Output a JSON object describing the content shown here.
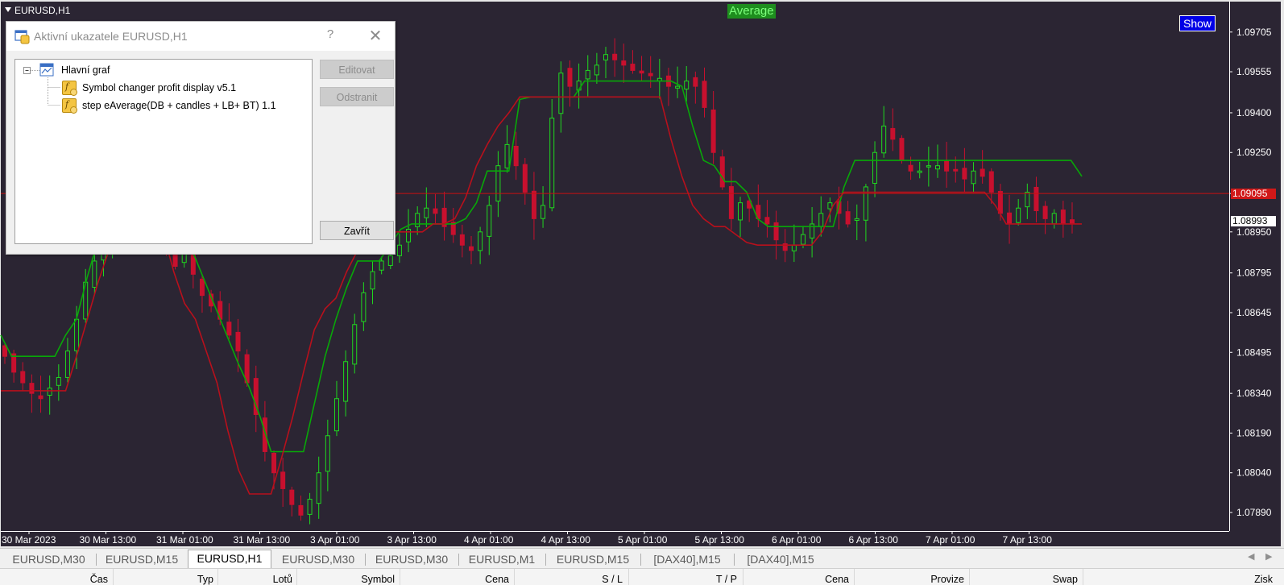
{
  "chart": {
    "title": "EURUSD,H1",
    "indicator_label": "Average",
    "show_button": "Show",
    "bid_price": "1.09095",
    "ask_price": "1.08993",
    "colors": {
      "background": "#2b2533",
      "bull": "#1fd81f",
      "bear": "#c8102e",
      "upper_line": "#08a808",
      "lower_line": "#b8101c",
      "price_line": "#c81010"
    }
  },
  "chart_data": {
    "type": "candlestick",
    "symbol": "EURUSD",
    "timeframe": "H1",
    "ylim": [
      1.0782,
      1.0982
    ],
    "y_ticks": [
      "1.09705",
      "1.09555",
      "1.09400",
      "1.09250",
      "1.09095",
      "1.08950",
      "1.08795",
      "1.08645",
      "1.08495",
      "1.08340",
      "1.08190",
      "1.08040",
      "1.07890"
    ],
    "x_ticks": [
      "30 Mar 2023",
      "30 Mar 13:00",
      "31 Mar 01:00",
      "31 Mar 13:00",
      "3 Apr 01:00",
      "3 Apr 13:00",
      "4 Apr 01:00",
      "4 Apr 13:00",
      "5 Apr 01:00",
      "5 Apr 13:00",
      "6 Apr 01:00",
      "6 Apr 13:00",
      "7 Apr 01:00",
      "7 Apr 13:00"
    ],
    "close_series": [
      1.0848,
      1.0842,
      1.0838,
      1.0834,
      1.0832,
      1.0836,
      1.084,
      1.085,
      1.0862,
      1.0876,
      1.0884,
      1.089,
      1.09,
      1.0908,
      1.0912,
      1.0906,
      1.0898,
      1.0893,
      1.0888,
      1.0882,
      1.0888,
      1.0879,
      1.0871,
      1.0867,
      1.0862,
      1.0856,
      1.085,
      1.0838,
      1.0826,
      1.0812,
      1.0804,
      1.0798,
      1.0792,
      1.0788,
      1.0794,
      1.0804,
      1.0818,
      1.0832,
      1.0846,
      1.086,
      1.0872,
      1.088,
      1.0884,
      1.0886,
      1.089,
      1.0896,
      1.0902,
      1.0904,
      1.0902,
      1.0897,
      1.0894,
      1.089,
      1.0888,
      1.0895,
      1.0905,
      1.092,
      1.0928,
      1.092,
      1.091,
      1.09,
      1.0905,
      1.0938,
      1.0955,
      1.095,
      1.0952,
      1.0956,
      1.0958,
      1.0962,
      1.096,
      1.0958,
      1.0956,
      1.0955,
      1.0954,
      1.0953,
      1.095,
      1.095,
      1.0952,
      1.095,
      1.0942,
      1.0925,
      1.0912,
      1.09,
      1.0906,
      1.0904,
      1.09,
      1.0898,
      1.0892,
      1.0888,
      1.089,
      1.0894,
      1.0898,
      1.0902,
      1.0906,
      1.0902,
      1.0898,
      1.09,
      1.0912,
      1.0925,
      1.0935,
      1.093,
      1.0922,
      1.0918,
      1.0918,
      1.092,
      1.092,
      1.0918,
      1.0918,
      1.0915,
      1.0918,
      1.0916,
      1.091,
      1.0902,
      1.0898,
      1.0904,
      1.091,
      1.0903,
      1.09,
      1.0902,
      1.0898,
      1.0898
    ],
    "series": [
      {
        "name": "upper",
        "values": [
          1.0856,
          1.0848,
          1.0848,
          1.0848,
          1.0848,
          1.0848,
          1.0856,
          1.0862,
          1.0878,
          1.0892,
          1.09,
          1.0902,
          1.0905,
          1.091,
          1.091,
          1.091,
          1.0903,
          1.0895,
          1.0885,
          1.0875,
          1.0865,
          1.0855,
          1.0845,
          1.0836,
          1.0825,
          1.0812,
          1.0812,
          1.0812,
          1.0812,
          1.083,
          1.0848,
          1.0862,
          1.0874,
          1.0884,
          1.0884,
          1.0884,
          1.089,
          1.0896,
          1.0898,
          1.0898,
          1.0898,
          1.0898,
          1.0898,
          1.09,
          1.0906,
          1.0918,
          1.0918,
          1.0918,
          1.0945,
          1.0946,
          1.0946,
          1.0946,
          1.0946,
          1.0946,
          1.0952,
          1.0952,
          1.0952,
          1.0952,
          1.0952,
          1.0952,
          1.0952,
          1.0952,
          1.0952,
          1.095,
          1.0935,
          1.0922,
          1.092,
          1.0914,
          1.0914,
          1.091,
          1.09,
          1.0897,
          1.0897,
          1.0897,
          1.0897,
          1.0897,
          1.0897,
          1.0897,
          1.0912,
          1.0922,
          1.0922,
          1.0922,
          1.0922,
          1.0922,
          1.0922,
          1.0922,
          1.0922,
          1.0922,
          1.0922,
          1.0922,
          1.0922,
          1.0922,
          1.0922,
          1.0922,
          1.0922,
          1.0922,
          1.0922,
          1.0922,
          1.0922,
          1.0922,
          1.0916
        ]
      },
      {
        "name": "lower",
        "values": [
          1.0835,
          1.0835,
          1.0835,
          1.0835,
          1.0835,
          1.0835,
          1.0835,
          1.0848,
          1.0862,
          1.0876,
          1.0888,
          1.0893,
          1.0895,
          1.0895,
          1.0895,
          1.0895,
          1.088,
          1.0868,
          1.0862,
          1.085,
          1.0838,
          1.082,
          1.0805,
          1.0796,
          1.0796,
          1.0796,
          1.081,
          1.0825,
          1.0842,
          1.0858,
          1.0866,
          1.087,
          1.088,
          1.0888,
          1.0892,
          1.0892,
          1.0895,
          1.0895,
          1.0895,
          1.0895,
          1.0898,
          1.0898,
          1.09,
          1.0908,
          1.092,
          1.0928,
          1.0935,
          1.094,
          1.0946,
          1.0946,
          1.0946,
          1.0946,
          1.0946,
          1.0946,
          1.0946,
          1.0946,
          1.0946,
          1.0946,
          1.0946,
          1.0946,
          1.0946,
          1.0946,
          1.093,
          1.0916,
          1.0905,
          1.09,
          1.0897,
          1.0897,
          1.0894,
          1.0891,
          1.089,
          1.089,
          1.089,
          1.089,
          1.089,
          1.089,
          1.0895,
          1.0905,
          1.091,
          1.091,
          1.091,
          1.091,
          1.091,
          1.091,
          1.091,
          1.091,
          1.091,
          1.091,
          1.091,
          1.091,
          1.091,
          1.091,
          1.0905,
          1.0898,
          1.0898,
          1.0898,
          1.0898,
          1.0898,
          1.0898,
          1.0898,
          1.0898
        ]
      }
    ]
  },
  "dialog": {
    "title": "Aktivní ukazatele EURUSD,H1",
    "help": "?",
    "close": "✕",
    "tree_root": "Hlavní graf",
    "tree_items": [
      "Symbol changer profit display v5.1",
      "step eAverage(DB + candles + LB+ BT) 1.1"
    ],
    "btn_edit": "Editovat",
    "btn_remove": "Odstranit",
    "btn_close": "Zavřít"
  },
  "tabs": [
    "EURUSD,M30",
    "EURUSD,M15",
    "EURUSD,H1",
    "EURUSD,M30",
    "EURUSD,M30",
    "EURUSD,M1",
    "EURUSD,M15",
    "[DAX40],M15",
    "[DAX40],M15"
  ],
  "active_tab_index": 2,
  "tab_arrows": [
    "◀",
    "▶"
  ],
  "columns": [
    "Čas",
    "Typ",
    "Lotů",
    "Symbol",
    "Cena",
    "S / L",
    "T / P",
    "Cena",
    "Provize",
    "Swap",
    "Zisk"
  ]
}
